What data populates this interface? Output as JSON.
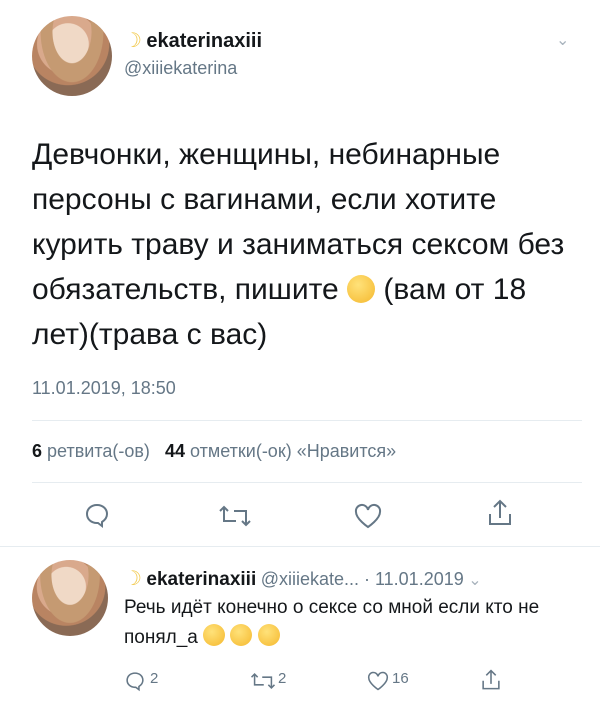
{
  "tweet": {
    "display_name": "ekaterinaxiii",
    "handle": "@xiiiekaterina",
    "text": "Девчонки, женщины, небинарные персоны с вагинами, если хотите курить траву и заниматься сексом без обязательств, пишите",
    "text_tail": "(вам от 18 лет)(трава с вас)",
    "timestamp": "11.01.2019, 18:50",
    "retweets_count": "6",
    "retweets_label": "ретвита(-ов)",
    "likes_count": "44",
    "likes_label": "отметки(-ок) «Нравится»"
  },
  "reply": {
    "display_name": "ekaterinaxiii",
    "handle_date": "@xiiiekate... · 11.01.2019",
    "text": "Речь идёт конечно о сексе со мной если кто не понял_а",
    "replies": "2",
    "retweets": "2",
    "likes": "16"
  },
  "icons": {
    "moon": "crescent-moon-icon",
    "chevron": "chevron-down-icon",
    "reply": "reply-icon",
    "retweet": "retweet-icon",
    "like": "heart-icon",
    "share": "share-icon",
    "emoji": "smirk-face-emoji"
  },
  "colors": {
    "text": "#14171a",
    "secondary": "#657786",
    "divider": "#e6ecf0"
  }
}
